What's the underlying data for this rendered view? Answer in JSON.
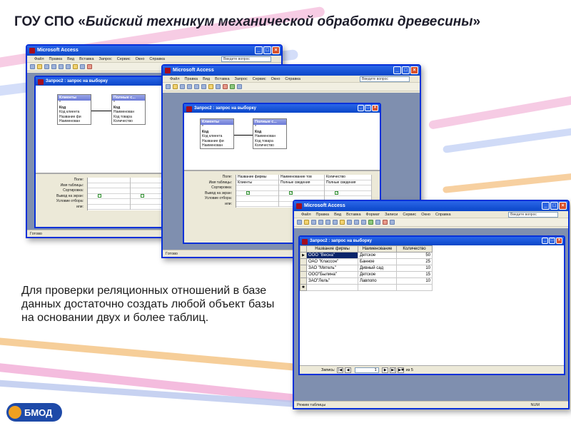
{
  "slide": {
    "title_prefix": "ГОУ СПО «",
    "title_italic": "Бийский техникум механической обработки древесины",
    "title_suffix": "»",
    "body": "Для проверки реляционных отношений в базе данных достаточно создать любой объект базы на основании двух и более таблиц.",
    "logo_text": "БМОД"
  },
  "app": {
    "title": "Microsoft Access",
    "ask_placeholder": "Введите вопрос",
    "menu": [
      "Файл",
      "Правка",
      "Вид",
      "Вставка",
      "Запрос",
      "Сервис",
      "Окно",
      "Справка"
    ],
    "menu_sheet": [
      "Файл",
      "Правка",
      "Вид",
      "Вставка",
      "Формат",
      "Записи",
      "Сервис",
      "Окно",
      "Справка"
    ],
    "status_ready": "Готово",
    "status_table": "Режим таблицы",
    "status_num": "NUM"
  },
  "query": {
    "title": "Запрос2 : запрос на выборку",
    "table1": {
      "name": "Клиенты",
      "fields": [
        "*",
        "Код",
        "Код клиента",
        "Название фи",
        "Наименован"
      ]
    },
    "table2": {
      "name": "Полные с...",
      "fields": [
        "*",
        "Код",
        "Наименован",
        "Код товара",
        "Количество"
      ]
    },
    "grid_labels": [
      "Поле:",
      "Имя таблицы:",
      "Сортировка:",
      "Вывод на экран:",
      "Условие отбора:",
      "или:"
    ],
    "columns": [
      {
        "field": "Название фирмы",
        "table": "Клиенты"
      },
      {
        "field": "Наименование тов",
        "table": "Полные сведения"
      },
      {
        "field": "Количество",
        "table": "Полные сведения"
      }
    ]
  },
  "sheet": {
    "title": "Запрос2 : запрос на выборку",
    "headers": [
      "Название фирмы",
      "Наименование",
      "Количество"
    ],
    "rows": [
      {
        "firm": "ООО \"Весна\"",
        "item": "Детское",
        "qty": "50"
      },
      {
        "firm": "ОАО \"Классон\"",
        "item": "Банное",
        "qty": "25"
      },
      {
        "firm": "ЗАО \"Мятель\"",
        "item": "Дивный сад",
        "qty": "10"
      },
      {
        "firm": "ООО\"Былина\"",
        "item": "Детское",
        "qty": "15"
      },
      {
        "firm": "ЗАО\"Лель\"",
        "item": "Лавпопо",
        "qty": "10"
      }
    ],
    "nav_label": "Запись:",
    "nav_current": "1",
    "nav_total": "из 5"
  }
}
